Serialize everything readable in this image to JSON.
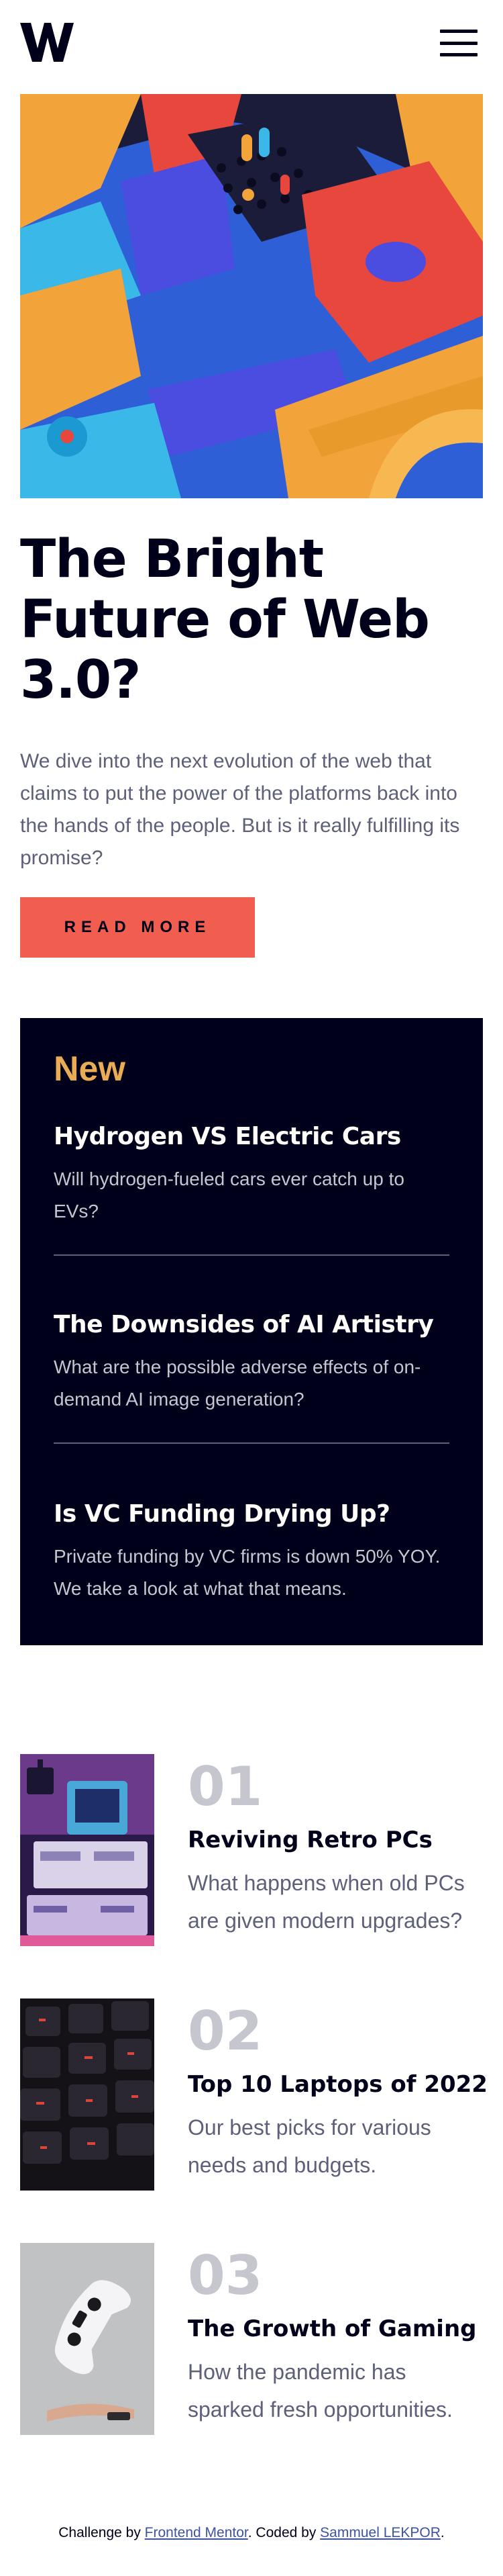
{
  "header": {
    "logo_text": "W.",
    "menu_icon": "hamburger-menu-icon"
  },
  "hero": {
    "title": "The Bright Future of Web 3.0?",
    "text": "We dive into the next evolution of the web that claims to put the power of the platforms back into the hands of the people. But is it really fulfilling its promise?",
    "button_label": "READ MORE"
  },
  "new_section": {
    "heading": "New",
    "items": [
      {
        "title": "Hydrogen VS Electric Cars",
        "text": "Will hydrogen-fueled cars ever catch up to EVs?"
      },
      {
        "title": "The Downsides of AI Artistry",
        "text": "What are the possible adverse effects of on-demand AI image generation?"
      },
      {
        "title": "Is VC Funding Drying Up?",
        "text": "Private funding by VC firms is down 50% YOY. We take a look at what that means."
      }
    ]
  },
  "list": [
    {
      "number": "01",
      "title": "Reviving Retro PCs",
      "text": "What happens when old PCs are given modern upgrades?"
    },
    {
      "number": "02",
      "title": "Top 10 Laptops of 2022",
      "text": "Our best picks for various needs and budgets."
    },
    {
      "number": "03",
      "title": "The Growth of Gaming",
      "text": "How the pandemic has sparked fresh opportunities."
    }
  ],
  "footer": {
    "prefix": "Challenge by ",
    "challenge_link": "Frontend Mentor",
    "middle": ". Coded by ",
    "author_link": "Sammuel LEKPOR",
    "suffix": "."
  },
  "colors": {
    "accent": "#f15e50",
    "dark_navy": "#00001a",
    "soft_orange": "#e9ab53",
    "grayish_blue": "#5e607a",
    "light_gray": "#c5c6ce"
  }
}
